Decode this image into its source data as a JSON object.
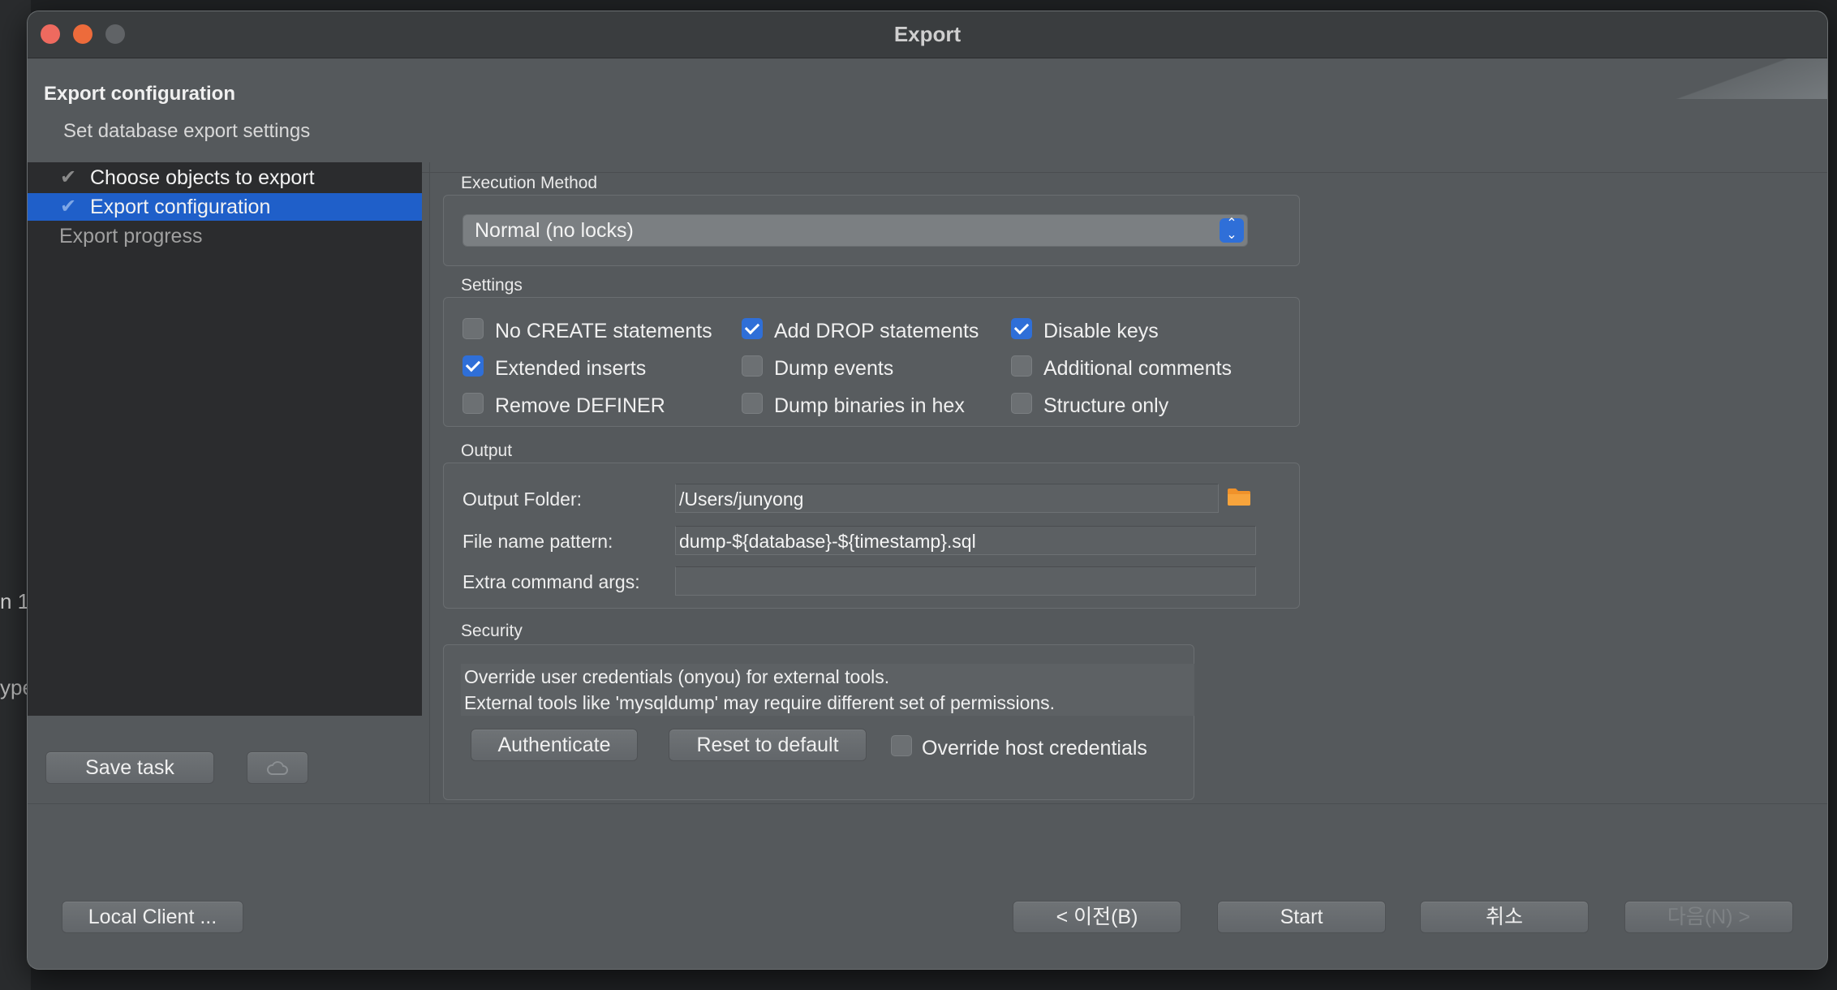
{
  "window": {
    "title": "Export"
  },
  "header": {
    "title": "Export configuration",
    "subtitle": "Set database export settings"
  },
  "nav": {
    "items": [
      {
        "label": "Choose objects to export",
        "state": "done"
      },
      {
        "label": "Export configuration",
        "state": "selected"
      },
      {
        "label": "Export progress",
        "state": "pending"
      }
    ],
    "save_task": "Save task"
  },
  "execution": {
    "section_label": "Execution Method",
    "selected": "Normal (no locks)"
  },
  "settings": {
    "section_label": "Settings",
    "options": [
      {
        "label": "No CREATE statements",
        "checked": false
      },
      {
        "label": "Add DROP statements",
        "checked": true
      },
      {
        "label": "Disable keys",
        "checked": true
      },
      {
        "label": "Extended inserts",
        "checked": true
      },
      {
        "label": "Dump events",
        "checked": false
      },
      {
        "label": "Additional comments",
        "checked": false
      },
      {
        "label": "Remove DEFINER",
        "checked": false
      },
      {
        "label": "Dump binaries in hex",
        "checked": false
      },
      {
        "label": "Structure only",
        "checked": false
      }
    ]
  },
  "output": {
    "section_label": "Output",
    "folder_label": "Output Folder:",
    "folder_value": "/Users/junyong",
    "pattern_label": "File name pattern:",
    "pattern_value": "dump-${database}-${timestamp}.sql",
    "args_label": "Extra command args:",
    "args_value": ""
  },
  "security": {
    "section_label": "Security",
    "line1": "Override user credentials (onyou) for external tools.",
    "line2": "External tools like 'mysqldump' may require different set of permissions.",
    "authenticate": "Authenticate",
    "reset": "Reset to default",
    "override_host_label": "Override host credentials",
    "override_host_checked": false
  },
  "footer": {
    "local_client": "Local Client ...",
    "prev": "< 이전(B)",
    "start": "Start",
    "cancel": "취소",
    "next": "다음(N) >"
  },
  "background": {
    "fragment1": "n 1",
    "fragment2": "ype"
  },
  "colors": {
    "accent": "#2f6fd8",
    "selection": "#1f5fc9",
    "folder": "#f0922a"
  }
}
